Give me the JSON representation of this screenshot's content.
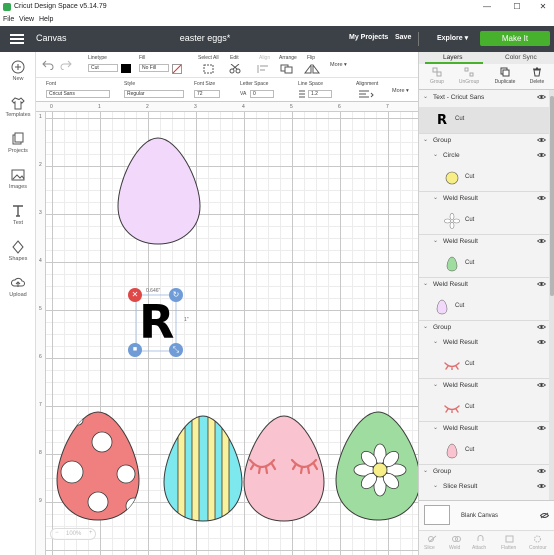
{
  "window": {
    "title": "Cricut Design Space  v5.14.79",
    "minimize": "—",
    "maximize": "☐",
    "close": "✕"
  },
  "menu": {
    "file": "File",
    "view": "View",
    "help": "Help"
  },
  "header": {
    "canvas_label": "Canvas",
    "project_title": "easter eggs*",
    "my_projects": "My Projects",
    "save": "Save",
    "explore": "Explore ▾",
    "make_it": "Make It"
  },
  "leftbar": [
    "New",
    "Templates",
    "Projects",
    "Images",
    "Text",
    "Shapes",
    "Upload"
  ],
  "toolbar1": {
    "linetype_label": "Linetype",
    "linetype_value": "Cut",
    "fill_label": "Fill",
    "fill_value": "No Fill",
    "select_all": "Select All",
    "edit": "Edit",
    "align": "Align",
    "arrange": "Arrange",
    "flip": "Flip",
    "more": "More ▾"
  },
  "toolbar2": {
    "font_label": "Font",
    "font_value": "Cricut Sans",
    "style_label": "Style",
    "style_value": "Regular",
    "fontsize_label": "Font Size",
    "fontsize_value": "72",
    "letterspace_label": "Letter Space",
    "letterspace_value": "0",
    "linespace_label": "Line Space",
    "linespace_value": "1.2",
    "alignment_label": "Alignment",
    "more": "More ▾"
  },
  "ruler": {
    "top": [
      "0",
      "1",
      "2",
      "3",
      "4",
      "5",
      "6",
      "7"
    ],
    "left": [
      "1",
      "2",
      "3",
      "4",
      "5",
      "6",
      "7",
      "8",
      "9"
    ]
  },
  "canvas": {
    "selected_text": "R",
    "width_readout": "0.646\"",
    "height_readout": "1\"",
    "zoom": "100%",
    "colors": {
      "purple_egg": "#f2d9fb",
      "red_egg": "#f08080",
      "stripe_blue": "#7ee8ef",
      "stripe_yellow": "#f8f29c",
      "pink_egg": "#f9c4d0",
      "lash": "#e07070",
      "green_egg": "#9fdc9f",
      "flower_center": "#f7ee88",
      "selection": "#6f9bd6",
      "delete": "#e04848"
    }
  },
  "panel": {
    "tabs": [
      "Layers",
      "Color Sync"
    ],
    "actions": [
      "Group",
      "UnGroup",
      "Duplicate",
      "Delete"
    ],
    "layers": [
      {
        "kind": "header",
        "label": "Text - Cricut Sans",
        "indent": 0
      },
      {
        "kind": "item",
        "label": "Cut",
        "thumb": "R",
        "indent": 0
      },
      {
        "kind": "header",
        "label": "Group",
        "indent": 0
      },
      {
        "kind": "header",
        "label": "Circle",
        "indent": 1
      },
      {
        "kind": "item",
        "label": "Cut",
        "thumb": "circle-yellow",
        "indent": 1
      },
      {
        "kind": "header",
        "label": "Weld Result",
        "indent": 1
      },
      {
        "kind": "item",
        "label": "Cut",
        "thumb": "flower",
        "indent": 1
      },
      {
        "kind": "header",
        "label": "Weld Result",
        "indent": 1
      },
      {
        "kind": "item",
        "label": "Cut",
        "thumb": "egg-green",
        "indent": 1
      },
      {
        "kind": "header",
        "label": "Weld Result",
        "indent": 0
      },
      {
        "kind": "item",
        "label": "Cut",
        "thumb": "egg-purple",
        "indent": 0
      },
      {
        "kind": "header",
        "label": "Group",
        "indent": 0
      },
      {
        "kind": "header",
        "label": "Weld Result",
        "indent": 1
      },
      {
        "kind": "item",
        "label": "Cut",
        "thumb": "lash",
        "indent": 1
      },
      {
        "kind": "header",
        "label": "Weld Result",
        "indent": 1
      },
      {
        "kind": "item",
        "label": "Cut",
        "thumb": "lash",
        "indent": 1
      },
      {
        "kind": "header",
        "label": "Weld Result",
        "indent": 1
      },
      {
        "kind": "item",
        "label": "Cut",
        "thumb": "egg-pink",
        "indent": 1
      },
      {
        "kind": "header",
        "label": "Group",
        "indent": 0
      },
      {
        "kind": "header",
        "label": "Slice Result",
        "indent": 1
      },
      {
        "kind": "item",
        "label": "Cut",
        "thumb": "partial",
        "indent": 1
      }
    ],
    "blank_canvas": "Blank Canvas",
    "bottom_actions": [
      "Slice",
      "Weld",
      "Attach",
      "Flatten",
      "Contour"
    ]
  }
}
